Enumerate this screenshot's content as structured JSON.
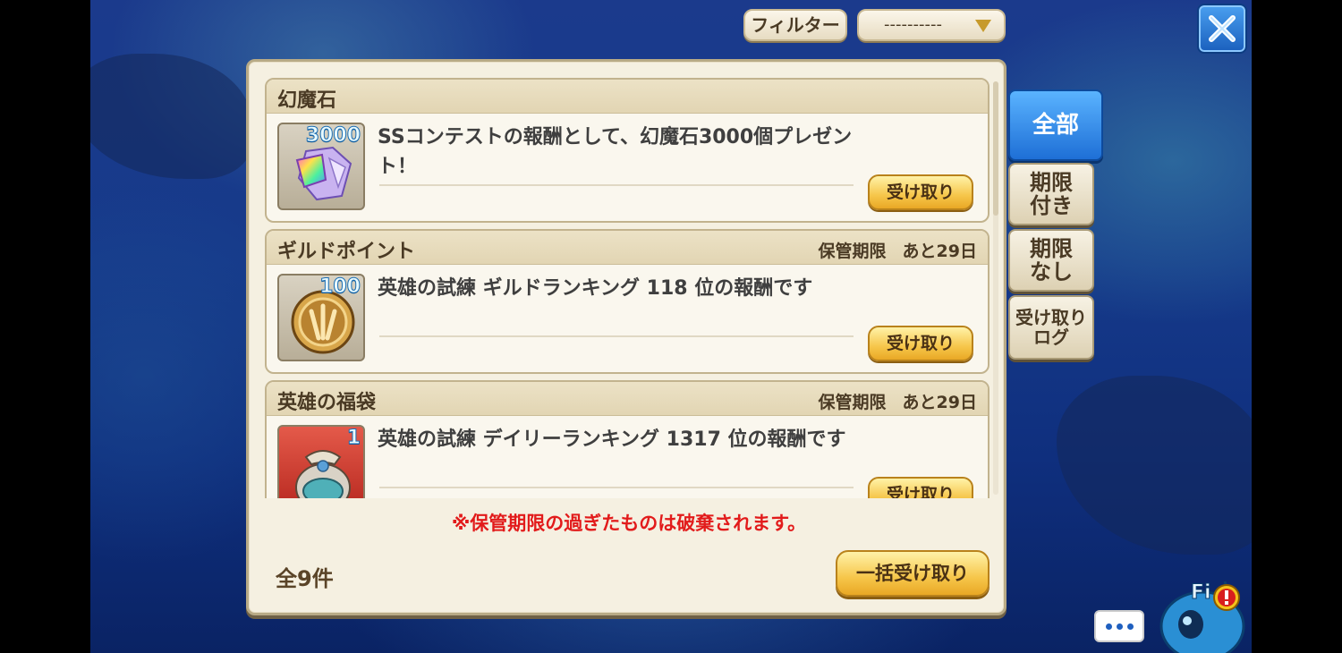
{
  "filter": {
    "button_label": "フィルター",
    "select_value": "----------"
  },
  "items": [
    {
      "title": "幻魔石",
      "expiry_label": "",
      "expiry_value": "",
      "count": "3000",
      "description": "SSコンテストの報酬として、幻魔石3000個プレゼント！",
      "receive_label": "受け取り"
    },
    {
      "title": "ギルドポイント",
      "expiry_label": "保管期限",
      "expiry_value": "あと29日",
      "count": "100",
      "description": "英雄の試練 ギルドランキング 118 位の報酬です",
      "receive_label": "受け取り"
    },
    {
      "title": "英雄の福袋",
      "expiry_label": "保管期限",
      "expiry_value": "あと29日",
      "count": "1",
      "description": "英雄の試練 デイリーランキング 1317 位の報酬です",
      "receive_label": "受け取り"
    }
  ],
  "notice": "※保管期限の過ぎたものは破棄されます。",
  "total": "全9件",
  "bulk_receive_label": "一括受け取り",
  "tabs": {
    "all": "全部",
    "limited": "期限付き",
    "unlimited": "期限なし",
    "log": "受け取りログ"
  },
  "mascot_text": "Fi",
  "colors": {
    "accent_blue": "#1e6fd6",
    "notice_red": "#e21b1b",
    "button_gold": "#f6c64a"
  }
}
